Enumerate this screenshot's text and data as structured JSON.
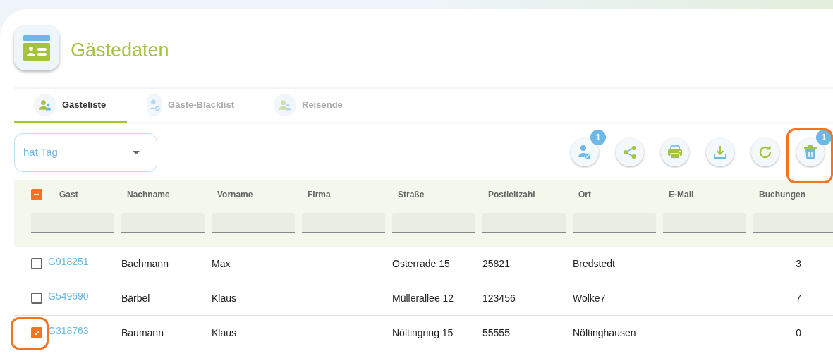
{
  "header": {
    "title": "Gästedaten"
  },
  "tabs": [
    {
      "label": "Gästeliste",
      "selected": true,
      "kind": "guests"
    },
    {
      "label": "Gäste-Blacklist",
      "selected": false,
      "kind": "blacklist"
    },
    {
      "label": "Reisende",
      "selected": false,
      "kind": "travelers"
    }
  ],
  "filter": {
    "value": "hat Tag"
  },
  "toolbar": [
    {
      "kind": "blacklist",
      "badge": "1",
      "highlighted": false
    },
    {
      "kind": "share",
      "highlighted": false
    },
    {
      "kind": "print",
      "highlighted": false
    },
    {
      "kind": "download",
      "highlighted": false
    },
    {
      "kind": "refresh",
      "highlighted": false
    },
    {
      "kind": "delete",
      "badge": "1",
      "highlighted": true
    }
  ],
  "table": {
    "select_all": {
      "indeterminate": true
    },
    "columns": [
      "Gast",
      "Nachname",
      "Vorname",
      "Firma",
      "Straße",
      "Postleitzahl",
      "Ort",
      "E-Mail",
      "Buchungen"
    ],
    "rows": [
      {
        "checked": false,
        "highlighted": false,
        "cells": [
          "G918251",
          "Bachmann",
          "Max",
          "",
          "Osterrade 15",
          "25821",
          "Bredstedt",
          "",
          "3"
        ]
      },
      {
        "checked": false,
        "highlighted": false,
        "cells": [
          "G549690",
          "Bärbel",
          "Klaus",
          "",
          "Müllerallee 12",
          "123456",
          "Wolke7",
          "",
          "7"
        ]
      },
      {
        "checked": true,
        "highlighted": true,
        "cells": [
          "G318763",
          "Baumann",
          "Klaus",
          "",
          "Nöltingring 15",
          "55555",
          "Nöltinghausen",
          "",
          "0"
        ]
      }
    ]
  }
}
